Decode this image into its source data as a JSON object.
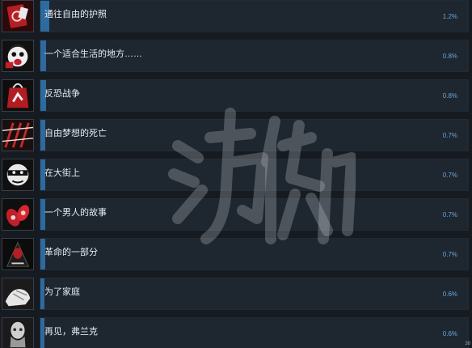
{
  "achievements": [
    {
      "name": "通往自由的护照",
      "percent": "1.2%",
      "fraction": 0.012,
      "icon": "passport-icon"
    },
    {
      "name": "一个适合生活的地方……",
      "percent": "0.8%",
      "fraction": 0.008,
      "icon": "screaming-face-icon"
    },
    {
      "name": "反恐战争",
      "percent": "0.8%",
      "fraction": 0.008,
      "icon": "red-bag-icon"
    },
    {
      "name": "自由梦想的死亡",
      "percent": "0.7%",
      "fraction": 0.007,
      "icon": "barbed-wire-icon"
    },
    {
      "name": "在大街上",
      "percent": "0.7%",
      "fraction": 0.007,
      "icon": "masked-face-icon"
    },
    {
      "name": "一个男人的故事",
      "percent": "0.7%",
      "fraction": 0.007,
      "icon": "red-coins-icon"
    },
    {
      "name": "革命的一部分",
      "percent": "0.7%",
      "fraction": 0.007,
      "icon": "hooded-figure-icon"
    },
    {
      "name": "为了家庭",
      "percent": "0.6%",
      "fraction": 0.006,
      "icon": "hands-icon"
    },
    {
      "name": "再见，弗兰克",
      "percent": "0.6%",
      "fraction": 0.006,
      "icon": "old-man-icon"
    }
  ],
  "watermark_text": "游侠网",
  "corner_text": "38",
  "colors": {
    "row_bg": "#1e2630",
    "progress_fill": "#2d6a9f",
    "percent_text": "#6ea6d8",
    "name_text": "#e7ecf1",
    "page_bg": "#161b22"
  }
}
